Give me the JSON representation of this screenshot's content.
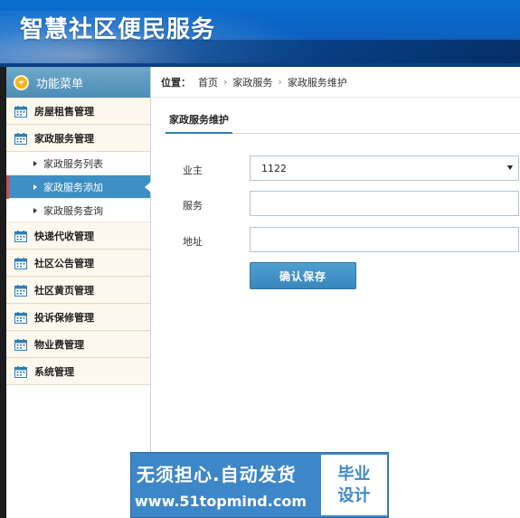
{
  "header": {
    "title": "智慧社区便民服务"
  },
  "sidebar": {
    "menu_title": "功能菜单",
    "groups": [
      {
        "label": "房屋租售管理"
      },
      {
        "label": "家政服务管理",
        "subitems": [
          {
            "label": "家政服务列表"
          },
          {
            "label": "家政服务添加",
            "active": true
          },
          {
            "label": "家政服务查询"
          }
        ]
      },
      {
        "label": "快递代收管理"
      },
      {
        "label": "社区公告管理"
      },
      {
        "label": "社区黄页管理"
      },
      {
        "label": "投诉保修管理"
      },
      {
        "label": "物业费管理"
      },
      {
        "label": "系统管理"
      }
    ]
  },
  "breadcrumb": {
    "label": "位置：",
    "items": [
      "首页",
      "家政服务",
      "家政服务维护"
    ]
  },
  "form": {
    "tab": "家政服务维护",
    "owner_label": "业主",
    "owner_value": "1122",
    "service_label": "服务",
    "service_value": "",
    "address_label": "地址",
    "address_value": "",
    "submit": "确认保存"
  },
  "watermark": {
    "line1": "无须担心.自动发货",
    "line2": "www.51topmind.com",
    "box_line1": "毕业",
    "box_line2": "设计"
  },
  "colors": {
    "header_blue": "#0b5fbf",
    "menu_head": "#4d8db5",
    "active_item": "#3d8fc4",
    "button": "#3a86bd",
    "group_bg": "#fdf9ee"
  },
  "icons": {
    "menu_head": "chevron-down-circle-icon",
    "group": "calendar-icon",
    "subitem": "triangle-right-icon",
    "breadcrumb_sep": "chevron-right-icon",
    "select": "caret-down-icon"
  }
}
